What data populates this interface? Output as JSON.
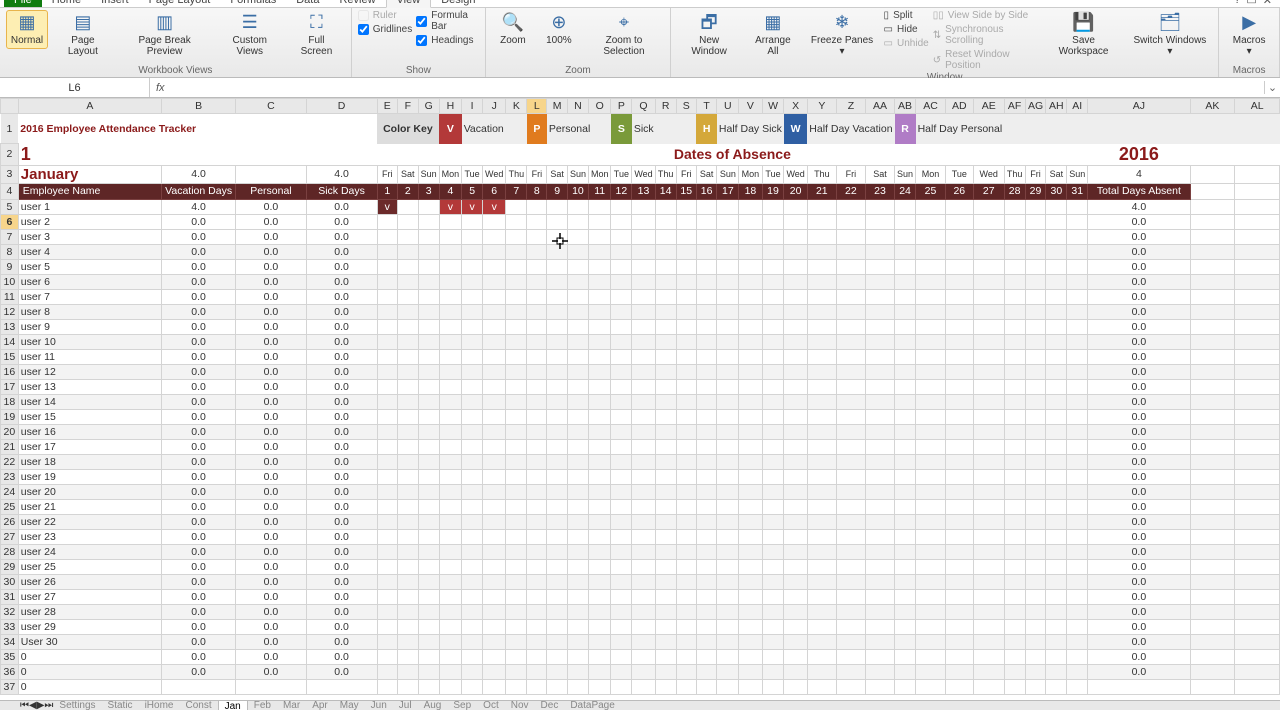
{
  "ribbon_tabs": [
    "File",
    "Home",
    "Insert",
    "Page Layout",
    "Formulas",
    "Data",
    "Review",
    "View",
    "Design"
  ],
  "ribbon_active": "View",
  "window_ctrls": [
    "?",
    "▭",
    "✕"
  ],
  "ribbon": {
    "workbook_views": {
      "label": "Workbook Views",
      "normal": "Normal",
      "page_layout": "Page\nLayout",
      "page_break": "Page Break\nPreview",
      "custom": "Custom\nViews",
      "full": "Full\nScreen"
    },
    "show": {
      "label": "Show",
      "ruler": "Ruler",
      "gridlines": "Gridlines",
      "formula_bar": "Formula Bar",
      "headings": "Headings"
    },
    "zoom": {
      "label": "Zoom",
      "zoom": "Zoom",
      "hundred": "100%",
      "selection": "Zoom to\nSelection"
    },
    "window": {
      "label": "Window",
      "new": "New\nWindow",
      "arrange": "Arrange\nAll",
      "freeze": "Freeze\nPanes ▾",
      "split": "Split",
      "hide": "Hide",
      "unhide": "Unhide",
      "sbs": "View Side by Side",
      "sync": "Synchronous Scrolling",
      "reset": "Reset Window Position",
      "save": "Save\nWorkspace",
      "switch": "Switch\nWindows ▾"
    },
    "macros": {
      "label": "Macros",
      "macros": "Macros\n▾"
    }
  },
  "namebox": "L6",
  "title": "2016 Employee Attendance Tracker",
  "year": "2016",
  "month_index": "1",
  "month_name": "January",
  "dates_of_absence": "Dates of Absence",
  "cols_letters": [
    "A",
    "B",
    "C",
    "D",
    "E",
    "F",
    "G",
    "H",
    "I",
    "J",
    "K",
    "L",
    "M",
    "N",
    "O",
    "P",
    "Q",
    "R",
    "S",
    "T",
    "U",
    "V",
    "W",
    "X",
    "Y",
    "Z",
    "AA",
    "AB",
    "AC",
    "AD",
    "AE",
    "AF",
    "AG",
    "AH",
    "AI",
    "AJ",
    "AK",
    "AL"
  ],
  "col_sel": "L",
  "col_widths": {
    "row": 18,
    "A": 155,
    "B": 75,
    "C": 75,
    "D": 75,
    "day": 21,
    "AJ": 105,
    "AK": 50,
    "AL": 50
  },
  "color_key": {
    "label": "Color Key",
    "items": [
      {
        "code": "V",
        "color": "#b33939",
        "name": "Vacation"
      },
      {
        "code": "P",
        "color": "#e07b1e",
        "name": "Personal"
      },
      {
        "code": "S",
        "color": "#7a9a3a",
        "name": "Sick"
      },
      {
        "code": "H",
        "color": "#d4a83a",
        "name": "Half Day Sick"
      },
      {
        "code": "W",
        "color": "#2f5fa3",
        "name": "Half Day Vacation"
      },
      {
        "code": "R",
        "color": "#b07cc6",
        "name": "Half Day Personal"
      }
    ]
  },
  "day_numbers": [
    "1",
    "2",
    "3",
    "4",
    "5",
    "6",
    "7",
    "8",
    "9",
    "10",
    "11",
    "12",
    "13",
    "14",
    "15",
    "16",
    "17",
    "18",
    "19",
    "20",
    "21",
    "22",
    "23",
    "24",
    "25",
    "26",
    "27",
    "28",
    "29",
    "30",
    "31"
  ],
  "day_names": [
    "Fri",
    "Sat",
    "Sun",
    "Mon",
    "Tue",
    "Wed",
    "Thu",
    "Fri",
    "Sat",
    "Sun",
    "Mon",
    "Tue",
    "Wed",
    "Thu",
    "Fri",
    "Sat",
    "Sun",
    "Mon",
    "Tue",
    "Wed",
    "Thu",
    "Fri",
    "Sat",
    "Sun",
    "Mon",
    "Tue",
    "Wed",
    "Thu",
    "Fri",
    "Sat",
    "Sun"
  ],
  "headers": {
    "emp": "Employee Name",
    "vac": "Vacation Days",
    "pers": "Personal",
    "sick": "Sick Days",
    "total": "Total Days Absent"
  },
  "row3_vals": {
    "B": "4.0",
    "D": "4.0",
    "AJ": "4"
  },
  "rows": [
    {
      "n": 5,
      "name": "user 1",
      "vac": "4.0",
      "pers": "0.0",
      "sick": "0.0",
      "total": "4.0",
      "marks": {
        "1": "v",
        "4": "v",
        "5": "v",
        "6": "v"
      }
    },
    {
      "n": 6,
      "name": "user 2",
      "vac": "0.0",
      "pers": "0.0",
      "sick": "0.0",
      "total": "0.0",
      "sel": true
    },
    {
      "n": 7,
      "name": "user 3",
      "vac": "0.0",
      "pers": "0.0",
      "sick": "0.0",
      "total": "0.0"
    },
    {
      "n": 8,
      "name": "user 4",
      "vac": "0.0",
      "pers": "0.0",
      "sick": "0.0",
      "total": "0.0"
    },
    {
      "n": 9,
      "name": "user 5",
      "vac": "0.0",
      "pers": "0.0",
      "sick": "0.0",
      "total": "0.0"
    },
    {
      "n": 10,
      "name": "user 6",
      "vac": "0.0",
      "pers": "0.0",
      "sick": "0.0",
      "total": "0.0"
    },
    {
      "n": 11,
      "name": "user 7",
      "vac": "0.0",
      "pers": "0.0",
      "sick": "0.0",
      "total": "0.0"
    },
    {
      "n": 12,
      "name": "user 8",
      "vac": "0.0",
      "pers": "0.0",
      "sick": "0.0",
      "total": "0.0"
    },
    {
      "n": 13,
      "name": "user 9",
      "vac": "0.0",
      "pers": "0.0",
      "sick": "0.0",
      "total": "0.0"
    },
    {
      "n": 14,
      "name": "user 10",
      "vac": "0.0",
      "pers": "0.0",
      "sick": "0.0",
      "total": "0.0"
    },
    {
      "n": 15,
      "name": "user 11",
      "vac": "0.0",
      "pers": "0.0",
      "sick": "0.0",
      "total": "0.0"
    },
    {
      "n": 16,
      "name": "user 12",
      "vac": "0.0",
      "pers": "0.0",
      "sick": "0.0",
      "total": "0.0"
    },
    {
      "n": 17,
      "name": "user 13",
      "vac": "0.0",
      "pers": "0.0",
      "sick": "0.0",
      "total": "0.0"
    },
    {
      "n": 18,
      "name": "user 14",
      "vac": "0.0",
      "pers": "0.0",
      "sick": "0.0",
      "total": "0.0"
    },
    {
      "n": 19,
      "name": "user 15",
      "vac": "0.0",
      "pers": "0.0",
      "sick": "0.0",
      "total": "0.0"
    },
    {
      "n": 20,
      "name": "user 16",
      "vac": "0.0",
      "pers": "0.0",
      "sick": "0.0",
      "total": "0.0"
    },
    {
      "n": 21,
      "name": "user 17",
      "vac": "0.0",
      "pers": "0.0",
      "sick": "0.0",
      "total": "0.0"
    },
    {
      "n": 22,
      "name": "user 18",
      "vac": "0.0",
      "pers": "0.0",
      "sick": "0.0",
      "total": "0.0"
    },
    {
      "n": 23,
      "name": "user 19",
      "vac": "0.0",
      "pers": "0.0",
      "sick": "0.0",
      "total": "0.0"
    },
    {
      "n": 24,
      "name": "user 20",
      "vac": "0.0",
      "pers": "0.0",
      "sick": "0.0",
      "total": "0.0"
    },
    {
      "n": 25,
      "name": "user 21",
      "vac": "0.0",
      "pers": "0.0",
      "sick": "0.0",
      "total": "0.0"
    },
    {
      "n": 26,
      "name": "user 22",
      "vac": "0.0",
      "pers": "0.0",
      "sick": "0.0",
      "total": "0.0"
    },
    {
      "n": 27,
      "name": "user 23",
      "vac": "0.0",
      "pers": "0.0",
      "sick": "0.0",
      "total": "0.0"
    },
    {
      "n": 28,
      "name": "user 24",
      "vac": "0.0",
      "pers": "0.0",
      "sick": "0.0",
      "total": "0.0"
    },
    {
      "n": 29,
      "name": "user 25",
      "vac": "0.0",
      "pers": "0.0",
      "sick": "0.0",
      "total": "0.0"
    },
    {
      "n": 30,
      "name": "user 26",
      "vac": "0.0",
      "pers": "0.0",
      "sick": "0.0",
      "total": "0.0"
    },
    {
      "n": 31,
      "name": "user 27",
      "vac": "0.0",
      "pers": "0.0",
      "sick": "0.0",
      "total": "0.0"
    },
    {
      "n": 32,
      "name": "user 28",
      "vac": "0.0",
      "pers": "0.0",
      "sick": "0.0",
      "total": "0.0"
    },
    {
      "n": 33,
      "name": "user 29",
      "vac": "0.0",
      "pers": "0.0",
      "sick": "0.0",
      "total": "0.0"
    },
    {
      "n": 34,
      "name": "User 30",
      "vac": "0.0",
      "pers": "0.0",
      "sick": "0.0",
      "total": "0.0"
    },
    {
      "n": 35,
      "name": "0",
      "vac": "0.0",
      "pers": "0.0",
      "sick": "0.0",
      "total": "0.0"
    },
    {
      "n": 36,
      "name": "0",
      "vac": "0.0",
      "pers": "0.0",
      "sick": "0.0",
      "total": "0.0"
    },
    {
      "n": 37,
      "name": "0",
      "vac": "",
      "pers": "",
      "sick": "",
      "total": ""
    }
  ],
  "sheet_tabs": [
    "Settings",
    "Static",
    "iHome",
    "Const",
    "Jan",
    "Feb",
    "Mar",
    "Apr",
    "May",
    "Jun",
    "Jul",
    "Aug",
    "Sep",
    "Oct",
    "Nov",
    "Dec",
    "DataPage"
  ],
  "sheet_active": "Jan"
}
